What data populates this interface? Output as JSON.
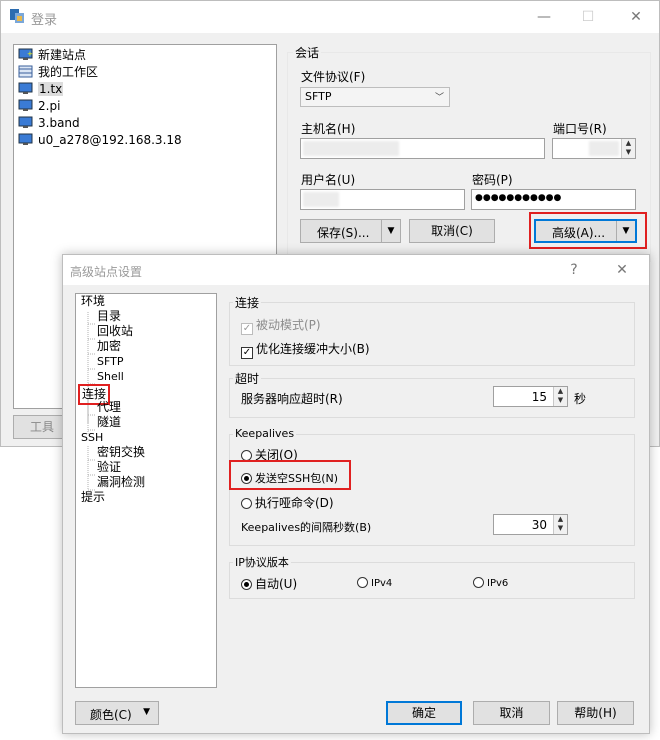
{
  "login_window": {
    "title": "登录",
    "title_controls": {
      "minimize": "—",
      "maximize": "☐",
      "close": "✕"
    },
    "site_tree": [
      {
        "label": "新建站点",
        "icon": "new-site-icon"
      },
      {
        "label": "我的工作区",
        "icon": "workspace-icon"
      },
      {
        "label": "1.tx",
        "icon": "computer-icon",
        "selected": true
      },
      {
        "label": "2.pi",
        "icon": "computer-icon"
      },
      {
        "label": "3.band",
        "icon": "computer-icon"
      },
      {
        "label": "u0_a278@192.168.3.18",
        "icon": "computer-icon"
      }
    ],
    "tools_button": "工具",
    "session": {
      "group_label": "会话",
      "protocol_label": "文件协议(F)",
      "protocol_value": "SFTP",
      "host_label": "主机名(H)",
      "port_label": "端口号(R)",
      "user_label": "用户名(U)",
      "password_label": "密码(P)",
      "password_value": "●●●●●●●●●●●",
      "save_button": "保存(S)...",
      "cancel_button": "取消(C)",
      "advanced_button": "高级(A)..."
    }
  },
  "advanced_dialog": {
    "title": "高级站点设置",
    "title_controls": {
      "help": "?",
      "close": "✕"
    },
    "tree": [
      {
        "label": "环境",
        "level": 0
      },
      {
        "label": "目录",
        "level": 1
      },
      {
        "label": "回收站",
        "level": 1
      },
      {
        "label": "加密",
        "level": 1
      },
      {
        "label": "SFTP",
        "level": 1
      },
      {
        "label": "Shell",
        "level": 1
      },
      {
        "label": "连接",
        "level": 0,
        "selected": true
      },
      {
        "label": "代理",
        "level": 1
      },
      {
        "label": "隧道",
        "level": 1
      },
      {
        "label": "SSH",
        "level": 0
      },
      {
        "label": "密钥交换",
        "level": 1
      },
      {
        "label": "验证",
        "level": 1
      },
      {
        "label": "漏洞检测",
        "level": 1
      },
      {
        "label": "提示",
        "level": 0
      }
    ],
    "connection": {
      "group_label": "连接",
      "passive_mode": "被动模式(P)",
      "optimize_buffer": "优化连接缓冲大小(B)"
    },
    "timeout": {
      "group_label": "超时",
      "label": "服务器响应超时(R)",
      "value": "15",
      "unit": "秒"
    },
    "keepalives": {
      "group_label": "Keepalives",
      "off": "关闭(O)",
      "send_null": "发送空SSH包(N)",
      "dummy_cmd": "执行哑命令(D)",
      "interval_label": "Keepalives的间隔秒数(B)",
      "interval_value": "30"
    },
    "ip_version": {
      "group_label": "IP协议版本",
      "auto": "自动(U)",
      "ipv4": "IPv4",
      "ipv6": "IPv6"
    },
    "color_button": "颜色(C)",
    "ok_button": "确定",
    "cancel_button": "取消",
    "help_button": "帮助(H)"
  }
}
